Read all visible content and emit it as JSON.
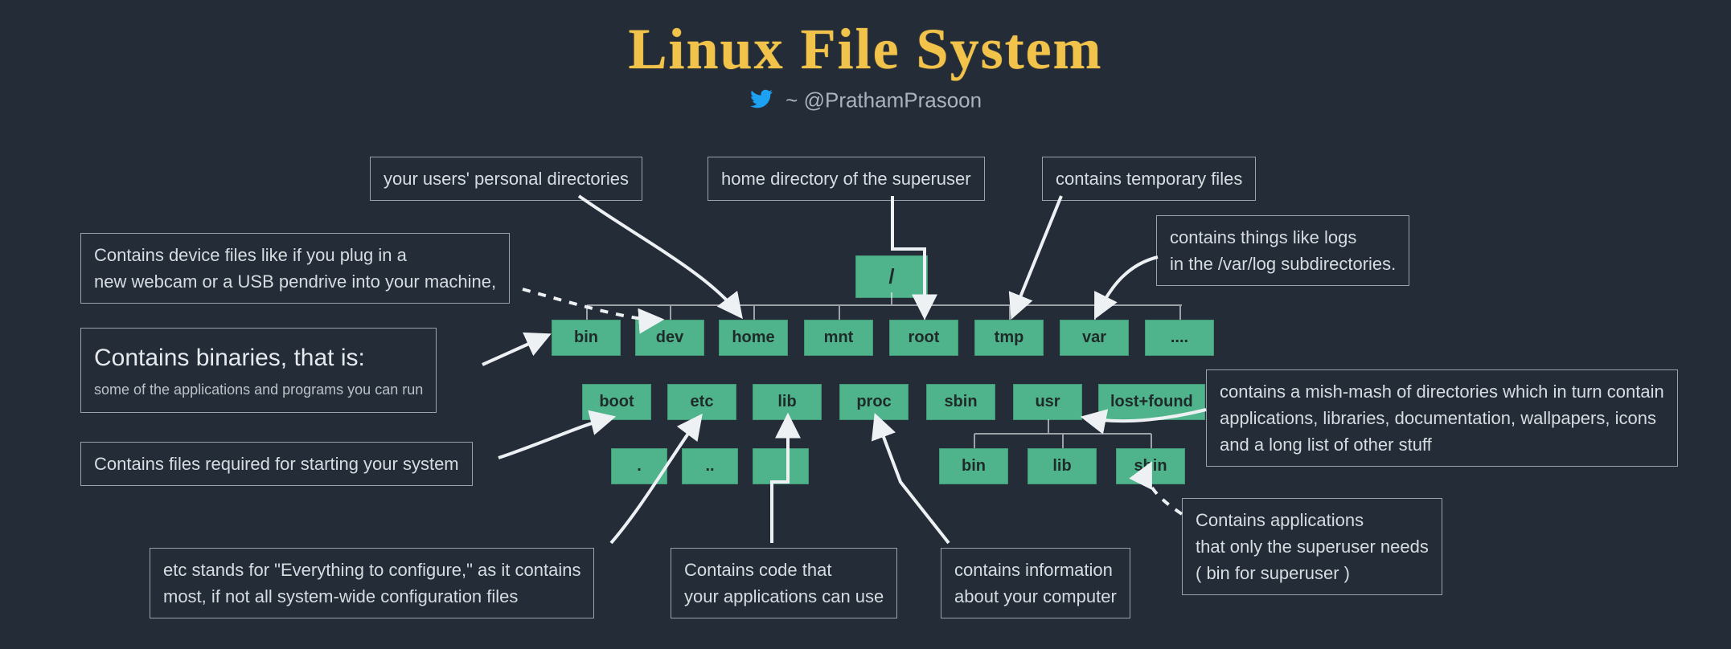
{
  "title": "Linux File System",
  "byline_prefix": "~ ",
  "byline_handle": "@PrathamPrasoon",
  "root_label": "/",
  "row1": [
    "bin",
    "dev",
    "home",
    "mnt",
    "root",
    "tmp",
    "var",
    "...."
  ],
  "row2": [
    "boot",
    "etc",
    "lib",
    "proc",
    "sbin",
    "usr",
    "lost+found"
  ],
  "row3_left": [
    ".",
    "..",
    ""
  ],
  "usr_children": [
    "bin",
    "lib",
    "sbin"
  ],
  "notes": {
    "home": "your users' personal directories",
    "rootdir": "home directory of the superuser",
    "tmp": "contains temporary files",
    "var_l1": "contains things like logs",
    "var_l2": "in the /var/log subdirectories.",
    "dev_l1": "Contains device files like if you plug in a",
    "dev_l2": "new webcam or a USB pendrive into your machine,",
    "bin_big": "Contains binaries, that is:",
    "bin_small": "some of the applications and programs you can run",
    "boot": "Contains files required for starting your system",
    "etc_l1": "etc stands for \"Everything to configure,\" as it contains",
    "etc_l2": "most, if not all system-wide configuration files",
    "lib_l1": "Contains code that",
    "lib_l2": "your applications can use",
    "proc_l1": "contains information",
    "proc_l2": "about your computer",
    "usr_l1": "contains a mish-mash of directories which in turn contain",
    "usr_l2": "applications, libraries, documentation, wallpapers, icons",
    "usr_l3": "and a long list of other stuff",
    "sbin_l1": "Contains applications",
    "sbin_l2": "that only the superuser needs",
    "sbin_l3": "( bin for superuser )"
  }
}
